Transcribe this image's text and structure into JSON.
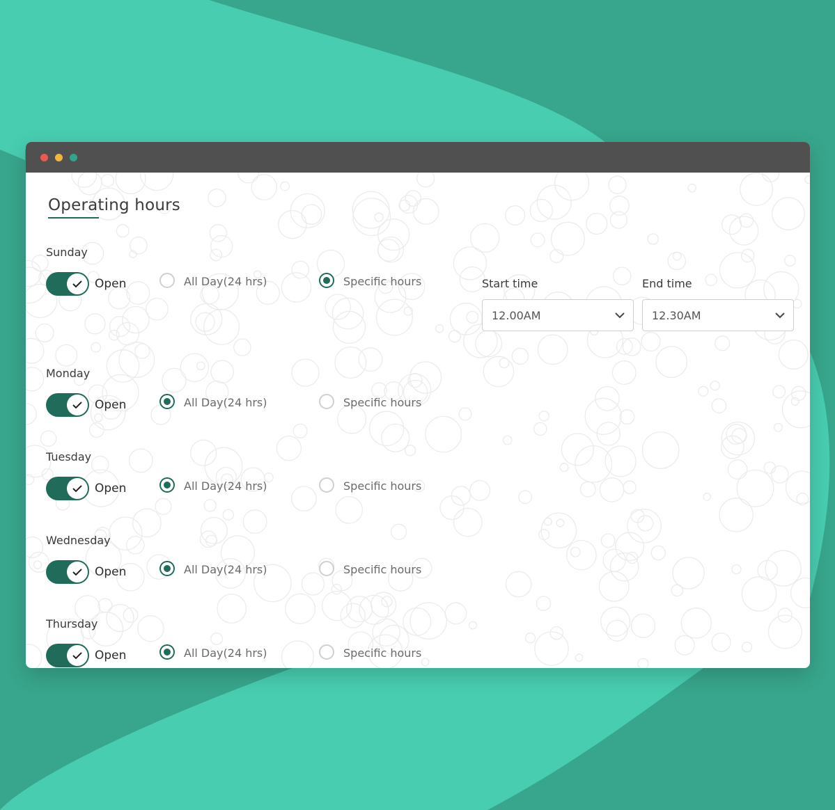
{
  "page": {
    "title": "Operating hours"
  },
  "colors": {
    "accent": "#216b5a",
    "background_teal": "#38a68c",
    "background_light_teal": "#48cdb0",
    "titlebar": "#505050"
  },
  "window_controls": [
    "close-dot",
    "minimize-dot",
    "maximize-dot"
  ],
  "time_fields": {
    "start_label": "Start time",
    "start_value": "12.00AM",
    "end_label": "End time",
    "end_value": "12.30AM"
  },
  "days": [
    {
      "name": "Sunday",
      "open_label": "Open",
      "is_open": true,
      "allday_label": "All Day(24 hrs)",
      "specific_label": "Specific hours",
      "selected": "specific"
    },
    {
      "name": "Monday",
      "open_label": "Open",
      "is_open": true,
      "allday_label": "All Day(24 hrs)",
      "specific_label": "Specific hours",
      "selected": "allday"
    },
    {
      "name": "Tuesday",
      "open_label": "Open",
      "is_open": true,
      "allday_label": "All Day(24 hrs)",
      "specific_label": "Specific hours",
      "selected": "allday"
    },
    {
      "name": "Wednesday",
      "open_label": "Open",
      "is_open": true,
      "allday_label": "All Day(24 hrs)",
      "specific_label": "Specific hours",
      "selected": "allday"
    },
    {
      "name": "Thursday",
      "open_label": "Open",
      "is_open": true,
      "allday_label": "All Day(24 hrs)",
      "specific_label": "Specific hours",
      "selected": "allday"
    }
  ]
}
